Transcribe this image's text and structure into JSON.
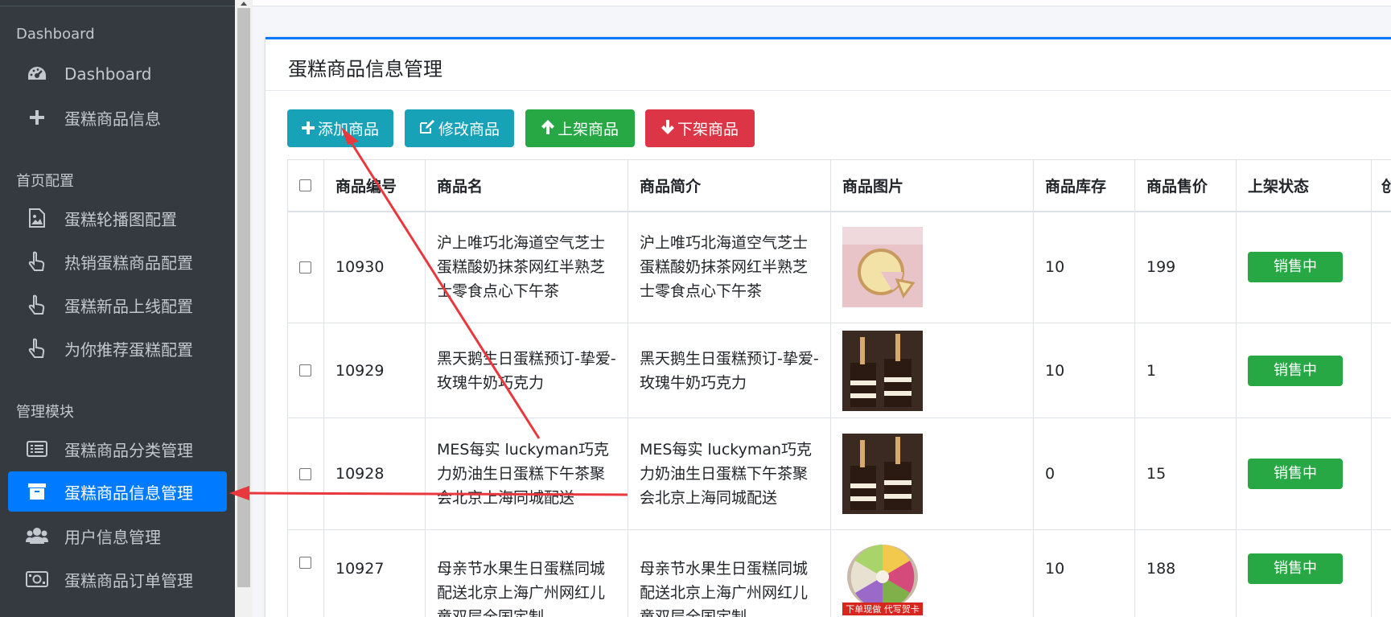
{
  "sidebar": {
    "sections": [
      {
        "header": "Dashboard"
      },
      {
        "header": "首页配置"
      },
      {
        "header": "管理模块"
      }
    ],
    "items": [
      {
        "label": "Dashboard",
        "icon": "gauge-icon"
      },
      {
        "label": "蛋糕商品信息",
        "icon": "plus-icon"
      },
      {
        "label": "蛋糕轮播图配置",
        "icon": "image-icon"
      },
      {
        "label": "热销蛋糕商品配置",
        "icon": "hand-pointer-icon"
      },
      {
        "label": "蛋糕新品上线配置",
        "icon": "hand-pointer-icon"
      },
      {
        "label": "为你推荐蛋糕配置",
        "icon": "hand-pointer-icon"
      },
      {
        "label": "蛋糕商品分类管理",
        "icon": "list-icon"
      },
      {
        "label": "蛋糕商品信息管理",
        "icon": "archive-icon",
        "active": true
      },
      {
        "label": "用户信息管理",
        "icon": "users-icon"
      },
      {
        "label": "蛋糕商品订单管理",
        "icon": "money-bill-icon"
      }
    ]
  },
  "card": {
    "title": "蛋糕商品信息管理"
  },
  "toolbar": {
    "add_label": "添加商品",
    "edit_label": "修改商品",
    "up_label": "上架商品",
    "down_label": "下架商品"
  },
  "table": {
    "columns": [
      "商品编号",
      "商品名",
      "商品简介",
      "商品图片",
      "商品库存",
      "商品售价",
      "上架状态",
      "创"
    ],
    "rows": [
      {
        "id": "10930",
        "name": "沪上唯巧北海道空气芝士蛋糕酸奶抹茶网红半熟芝士零食点心下午茶",
        "intro": "沪上唯巧北海道空气芝士蛋糕酸奶抹茶网红半熟芝士零食点心下午茶",
        "stock": "10",
        "price": "199",
        "status": "销售中"
      },
      {
        "id": "10929",
        "name": "黑天鹅生日蛋糕预订-挚爱-玫瑰牛奶巧克力",
        "intro": "黑天鹅生日蛋糕预订-挚爱-玫瑰牛奶巧克力",
        "stock": "10",
        "price": "1",
        "status": "销售中"
      },
      {
        "id": "10928",
        "name": "MES每实 luckyman巧克力奶油生日蛋糕下午茶聚会北京上海同城配送",
        "intro": "MES每实 luckyman巧克力奶油生日蛋糕下午茶聚会北京上海同城配送",
        "stock": "0",
        "price": "15",
        "status": "销售中"
      },
      {
        "id": "10927",
        "name": "母亲节水果生日蛋糕同城配送北京上海广州网红儿童双层全国定制",
        "intro": "母亲节水果生日蛋糕同城配送北京上海广州网红儿童双层全国定制",
        "stock": "10",
        "price": "188",
        "status": "销售中",
        "image_caption": "下单现做 代写贺卡"
      }
    ]
  },
  "colors": {
    "sidebar_bg": "#343a40",
    "active": "#007bff",
    "info": "#17a2b8",
    "success": "#28a745",
    "danger": "#dc3545",
    "annotation": "#e8383d"
  }
}
